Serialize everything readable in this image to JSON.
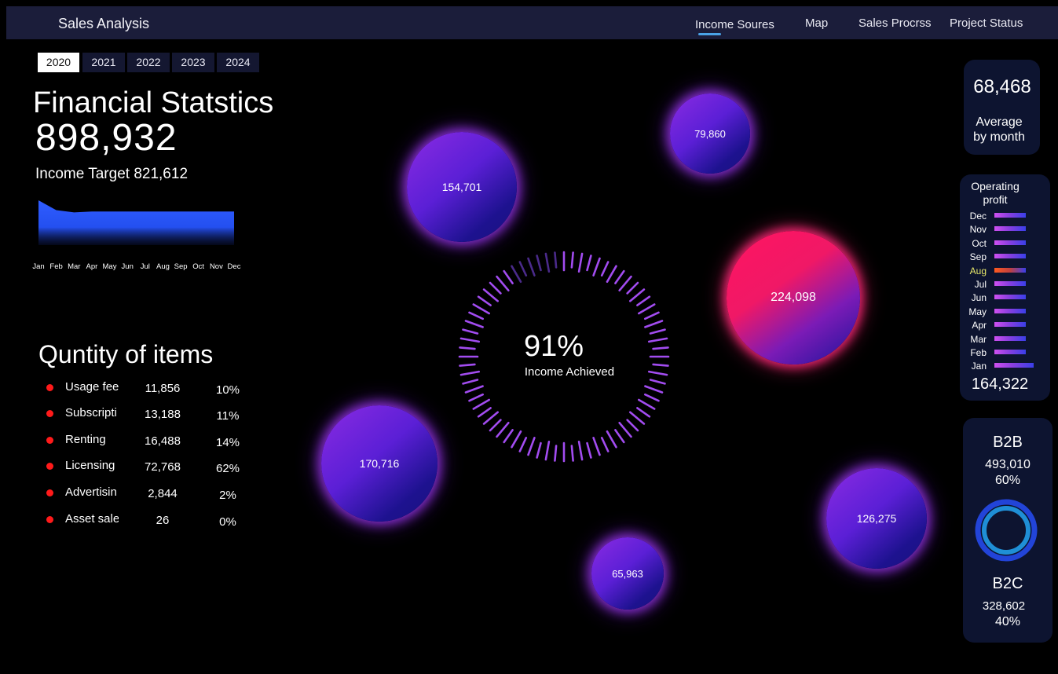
{
  "header": {
    "title": "Sales Analysis",
    "nav": [
      "Income Soures",
      "Map",
      "Sales Procrss",
      "Project Status"
    ],
    "active_nav": "Income Soures"
  },
  "years": [
    "2020",
    "2021",
    "2022",
    "2023",
    "2024"
  ],
  "selected_year": "2020",
  "financial": {
    "title": "Financial Statstics",
    "total": "898,932",
    "target_text": "Income Target 821,612"
  },
  "chart_data": {
    "type": "area",
    "categories": [
      "Jan",
      "Feb",
      "Mar",
      "Apr",
      "May",
      "Jun",
      "Jul",
      "Aug",
      "Sep",
      "Oct",
      "Nov",
      "Dec"
    ],
    "series": [
      {
        "values": [
          1.0,
          0.78,
          0.73,
          0.75,
          0.75,
          0.75,
          0.75,
          0.75,
          0.75,
          0.75,
          0.75,
          0.75
        ]
      }
    ],
    "ylim": [
      0,
      1
    ],
    "grid": false
  },
  "quantity": {
    "title": "Quntity of items",
    "rows": [
      {
        "label": "Usage fee",
        "value": "11,856",
        "pct": "10%"
      },
      {
        "label": "Subscripti",
        "value": "13,188",
        "pct": "11%"
      },
      {
        "label": "Renting",
        "value": "16,488",
        "pct": "14%"
      },
      {
        "label": "Licensing",
        "value": "72,768",
        "pct": "62%"
      },
      {
        "label": "Advertisin",
        "value": "2,844",
        "pct": "2%"
      },
      {
        "label": "Asset sale",
        "value": "26",
        "pct": "0%"
      }
    ]
  },
  "bubbles": [
    "154,701",
    "79,860",
    "224,098",
    "170,716",
    "126,275",
    "65,963"
  ],
  "dial": {
    "percent": "91%",
    "label": "Income Achieved",
    "fraction": 0.91
  },
  "average": {
    "value": "68,468",
    "label_line1": "Average",
    "label_line2": "by month"
  },
  "operating_profit": {
    "title_line1": "Operating",
    "title_line2": "profit",
    "months": [
      "Dec",
      "Nov",
      "Oct",
      "Sep",
      "Aug",
      "Jul",
      "Jun",
      "May",
      "Apr",
      "Mar",
      "Feb",
      "Jan"
    ],
    "highlighted": "Aug",
    "total": "164,322"
  },
  "segments": {
    "b2b": {
      "label": "B2B",
      "value": "493,010",
      "pct": "60%"
    },
    "b2c": {
      "label": "B2C",
      "value": "328,602",
      "pct": "40%"
    }
  },
  "colors": {
    "accent": "#4aa3e8",
    "area_fill": "#2f5cff",
    "bubble_purple": "#6a22d8",
    "bubble_pink": "#f01866",
    "dot_red": "#ff1a1a",
    "donut_inner": "#1f8fd6",
    "donut_outer": "#2244d8"
  }
}
